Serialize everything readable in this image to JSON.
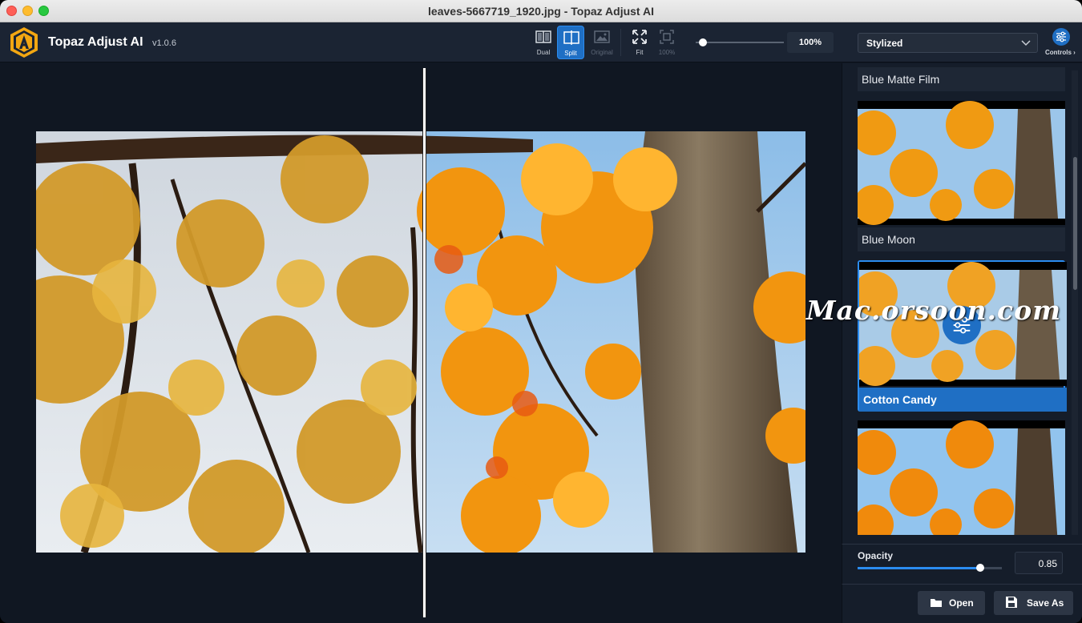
{
  "window": {
    "title": "leaves-5667719_1920.jpg - Topaz Adjust AI"
  },
  "app": {
    "name": "Topaz Adjust AI",
    "version": "v1.0.6"
  },
  "toolbar": {
    "view_modes": [
      {
        "label": "Dual",
        "state": "normal"
      },
      {
        "label": "Split",
        "state": "active"
      },
      {
        "label": "Original",
        "state": "disabled"
      }
    ],
    "fit_label": "Fit",
    "actual_size_label": "100%",
    "zoom": {
      "fraction": 0.08,
      "value": "100%"
    }
  },
  "style_selector": {
    "selected": "Stylized"
  },
  "controls": {
    "label": "Controls"
  },
  "styles": [
    {
      "name": "Blue Matte Film",
      "selected": false
    },
    {
      "name": "Blue Moon",
      "selected": false
    },
    {
      "name": "Cotton Candy",
      "selected": true
    }
  ],
  "watermark": "Mac.orsoon.com",
  "opacity": {
    "label": "Opacity",
    "value": "0.85",
    "fraction": 0.85
  },
  "footer": {
    "open_label": "Open",
    "save_as_label": "Save As"
  },
  "colors": {
    "accent": "#1f6fc4",
    "accent_light": "#2b8cf0",
    "background": "#0f1722",
    "panel": "#151d2a"
  }
}
